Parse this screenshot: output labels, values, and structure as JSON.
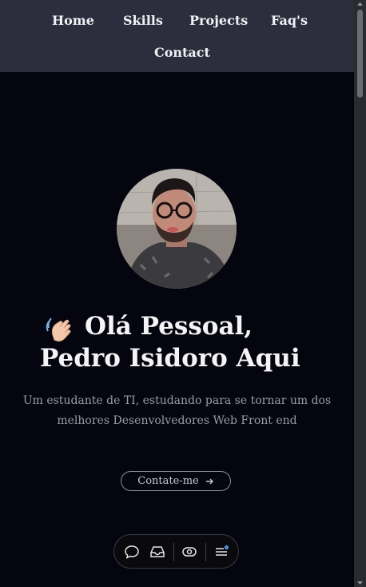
{
  "nav": {
    "items": [
      {
        "label": "Home"
      },
      {
        "label": "Skills"
      },
      {
        "label": "Projects"
      },
      {
        "label": "Faq's"
      },
      {
        "label": "Contact"
      }
    ]
  },
  "hero": {
    "title_line1": "Olá Pessoal,",
    "title_line2": "Pedro Isidoro Aqui",
    "subtitle_line1": "Um estudante de TI, estudando para se tornar um dos",
    "subtitle_line2": "melhores Desenvolvedores Web Front end",
    "cta_label": "Contate-me",
    "cta_icon": "arrow-right-icon",
    "avatar_icon": "profile-photo",
    "emoji_icon": "waving-hand-icon"
  },
  "dock": {
    "items": [
      {
        "icon": "chat-bubble-icon"
      },
      {
        "icon": "inbox-tray-icon"
      },
      {
        "icon": "eye-toggle-icon"
      },
      {
        "icon": "menu-icon"
      }
    ],
    "notification_color": "#4a90e2"
  },
  "colors": {
    "background": "#04050f",
    "nav_background": "#2c2e3d",
    "title": "#f4f4f6",
    "subtitle": "#9a9ca7"
  }
}
